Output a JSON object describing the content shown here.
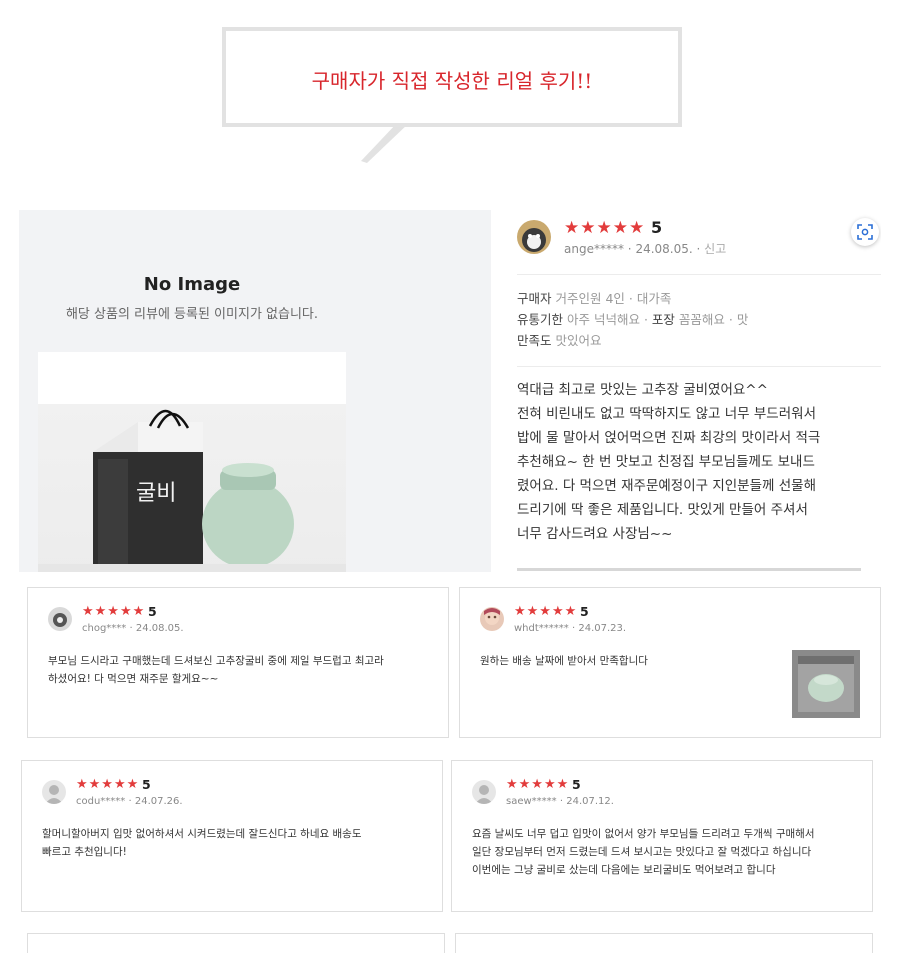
{
  "banner": {
    "text": "구매자가 직접 작성한 리얼 후기!!"
  },
  "main_review": {
    "no_image_title": "No Image",
    "no_image_sub": "해당 상품의 리뷰에 등록된 이미지가 없습니다.",
    "stars": "★★★★★",
    "score": "5",
    "user": "ange*****",
    "date": "24.08.05.",
    "report": "신고",
    "attrs": [
      {
        "key": "구매자",
        "value": "거주인원 4인 · 대가족",
        "key2": "",
        "value2": ""
      },
      {
        "key": "유통기한",
        "value": "아주 넉넉해요",
        "key2": "포장",
        "value2": "꼼꼼해요 · 맛"
      },
      {
        "key": "만족도",
        "value": "맛있어요",
        "key2": "",
        "value2": ""
      }
    ],
    "body_lines": [
      "역대급 최고로 맛있는 고추장 굴비였어요^^",
      "전혀 비린내도 없고 딱딱하지도 않고 너무 부드러워서",
      "밥에 물 말아서 얹어먹으면 진짜 최강의 맛이라서 적극",
      "추천해요~ 한 번 맛보고 친정집 부모님들께도 보내드",
      "렸어요. 다 먹으면 재주문예정이구 지인분들께 선물해",
      "드리기에 딱 좋은 제품입니다. 맛있게 만들어 주셔서",
      "너무 감사드려요 사장님~~"
    ]
  },
  "cards": [
    {
      "stars": "★★★★★",
      "score": "5",
      "user": "chog****",
      "date": "24.08.05.",
      "lines": [
        "부모님 드시라고 구매했는데 드셔보신 고추장굴비 중에 제일 부드럽고 최고라",
        "하셨어요! 다 먹으면 재주문 할게요~~"
      ]
    },
    {
      "stars": "★★★★★",
      "score": "5",
      "user": "whdt******",
      "date": "24.07.23.",
      "lines": [
        "원하는 배송 날짜에 받아서 만족합니다"
      ]
    },
    {
      "stars": "★★★★★",
      "score": "5",
      "user": "codu*****",
      "date": "24.07.26.",
      "lines": [
        "할머니할아버지 입맛 없어하셔서 시켜드렸는데 잘드신다고 하네요 배송도",
        "빠르고 추천입니다!"
      ]
    },
    {
      "stars": "★★★★★",
      "score": "5",
      "user": "saew*****",
      "date": "24.07.12.",
      "lines": [
        "요즘 날씨도 너무 덥고 입맛이 없어서 양가 부모님들 드리려고 두개씩 구매해서",
        "일단 장모님부터 먼저 드렸는데 드셔 보시고는 맛있다고 잘 먹겠다고 하십니다",
        "이번에는 그냥 굴비로 샀는데 다음에는 보리굴비도 먹어보려고 합니다"
      ]
    }
  ],
  "colors": {
    "accent_red": "#d8262c",
    "star_red": "#e23c3c"
  },
  "icons": {
    "scan": "scan-icon",
    "avatar_default": "user-silhouette-icon"
  }
}
